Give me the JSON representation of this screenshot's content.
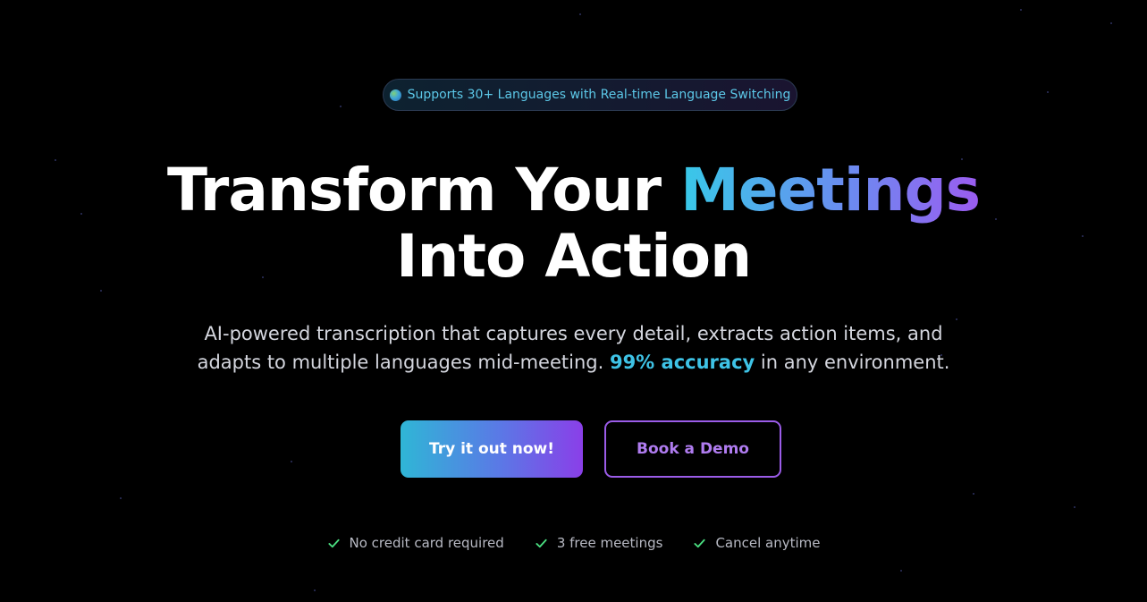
{
  "badge": {
    "icon": "globe-icon",
    "text": "Supports 30+ Languages with Real-time Language Switching"
  },
  "hero": {
    "headline_part1": "Transform Your ",
    "headline_highlight": "Meetings",
    "headline_part2": "Into Action",
    "subtitle_part1": "AI-powered transcription that captures every detail, extracts action items, and adapts to multiple languages mid-meeting. ",
    "subtitle_accent": "99% accuracy",
    "subtitle_part2": " in any environment."
  },
  "cta": {
    "primary_label": "Try it out now!",
    "secondary_label": "Book a Demo"
  },
  "benefits": [
    {
      "icon": "check-icon",
      "label": "No credit card required"
    },
    {
      "icon": "check-icon",
      "label": "3 free meetings"
    },
    {
      "icon": "check-icon",
      "label": "Cancel anytime"
    }
  ],
  "colors": {
    "background": "#000000",
    "accent_cyan": "#3ec3e6",
    "accent_purple": "#8a3fe8",
    "check_green": "#4ade80"
  }
}
